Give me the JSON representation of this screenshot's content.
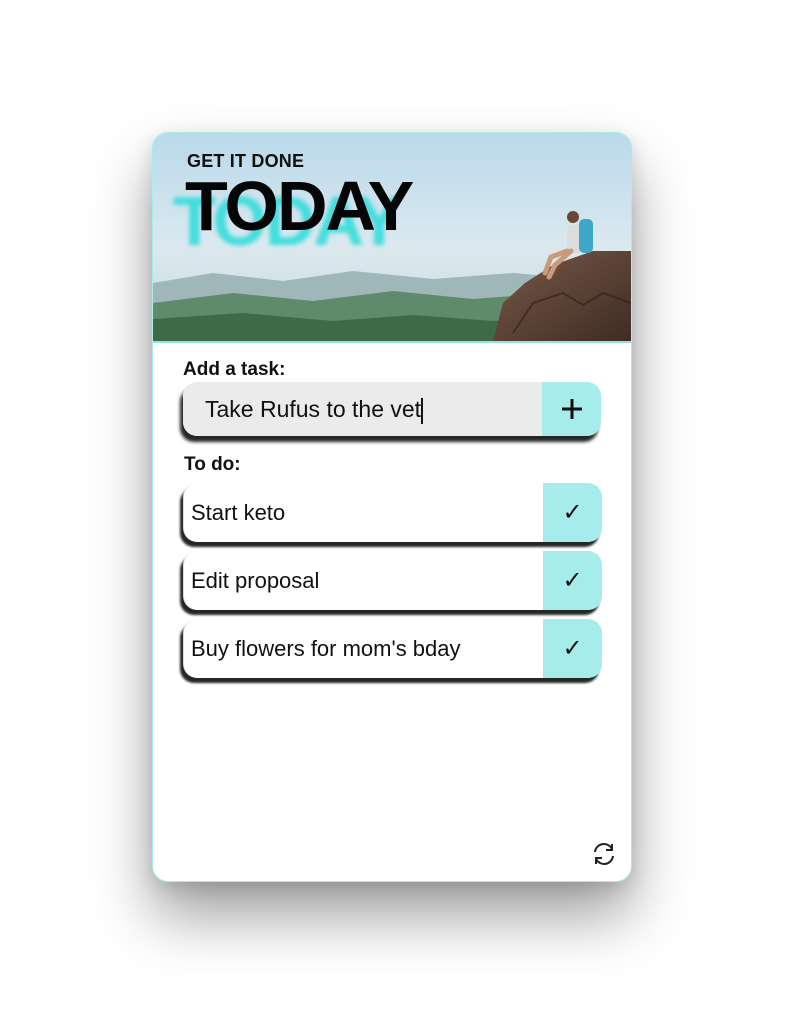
{
  "hero": {
    "kicker": "GET IT DONE",
    "title": "TODAY"
  },
  "add_task": {
    "label": "Add a task:",
    "input_value": "Take Rufus to the vet",
    "add_button_icon": "plus-icon"
  },
  "todo": {
    "label": "To do:",
    "tasks": [
      {
        "text": "Start keto"
      },
      {
        "text": "Edit proposal"
      },
      {
        "text": "Buy flowers for mom's bday"
      }
    ],
    "complete_icon": "check-icon"
  },
  "footer": {
    "refresh_icon": "refresh-icon"
  },
  "colors": {
    "accent": "#a6ecea",
    "border": "#a8ede8",
    "input_bg": "#ebebeb"
  }
}
